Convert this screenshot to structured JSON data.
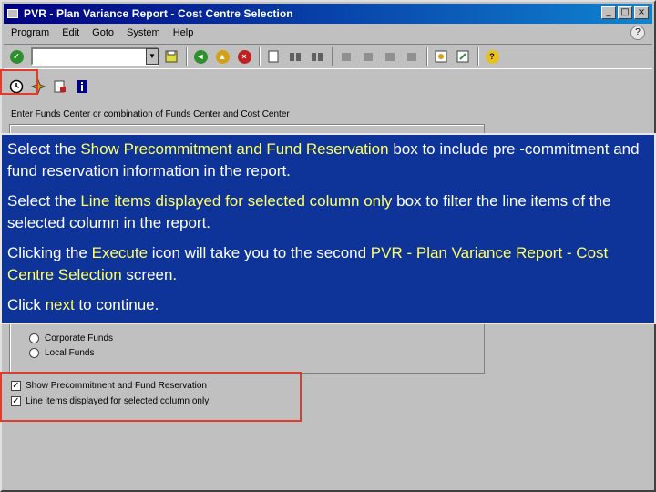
{
  "window": {
    "title": "PVR - Plan Variance Report - Cost Centre Selection",
    "buttons": [
      "_",
      "□",
      "×"
    ]
  },
  "menubar": {
    "items": [
      "Program",
      "Edit",
      "Goto",
      "System",
      "Help"
    ]
  },
  "toolbar": {
    "enter_icon": "check-icon",
    "save_icon": "save-icon",
    "command_field_value": ""
  },
  "app_toolbar": {
    "execute_icon": "execute-clock-icon",
    "icons": [
      "execute-clock-icon",
      "variant-icon",
      "delete-icon",
      "info-icon"
    ]
  },
  "content": {
    "section_label": "Enter Funds Center or combination of Funds Center and Cost Center",
    "radios": [
      "Corporate Funds",
      "Local Funds"
    ],
    "checkboxes": [
      {
        "label": "Show Precommitment and Fund Reservation",
        "checked": true
      },
      {
        "label": "Line items displayed for selected column only",
        "checked": true
      }
    ]
  },
  "instructions": {
    "p1_a": "Select the ",
    "p1_hl": "Show Precommitment and Fund Reservation",
    "p1_b": " box to include pre -commitment and fund reservation information in the report.",
    "p2_a": "Select the ",
    "p2_hl": "Line items displayed for selected column only",
    "p2_b": " box to filter the line items of the selected column in the report.",
    "p3_a": "Clicking the ",
    "p3_hl1": "Execute",
    "p3_b": " icon will take you to the second ",
    "p3_hl2": "PVR - Plan Variance Report - Cost Centre Selection",
    "p3_c": " screen.",
    "p4_a": "Click ",
    "p4_hl": "next",
    "p4_b": " to continue."
  },
  "colors": {
    "highlight_box": "#e03c2c",
    "instruction_bg": "#0e3399",
    "highlight_text": "#ffff66"
  }
}
